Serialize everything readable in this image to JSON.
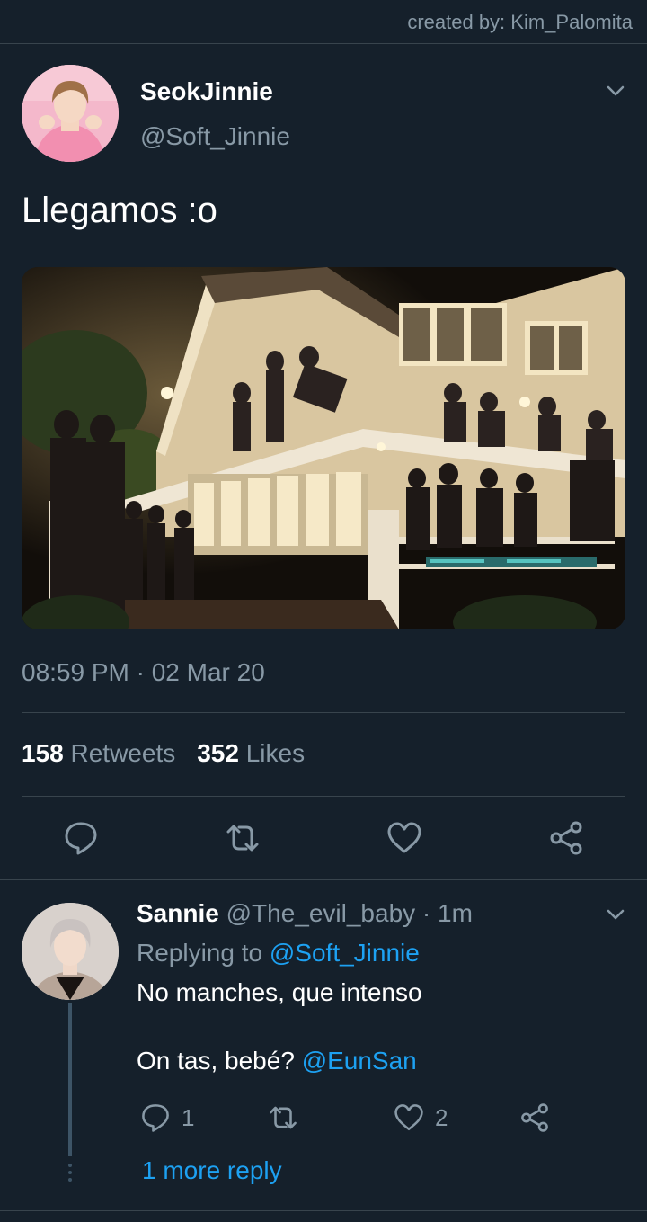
{
  "credit": "created by: Kim_Palomita",
  "tweet": {
    "display_name": "SeokJinnie",
    "handle": "@Soft_Jinnie",
    "text": "Llegamos :o",
    "timestamp": "08:59 PM · 02 Mar 20",
    "retweet_count": "158",
    "retweet_label": "Retweets",
    "like_count": "352",
    "like_label": "Likes"
  },
  "reply": {
    "display_name": "Sannie",
    "handle": "@The_evil_baby",
    "time": "· 1m",
    "replying_prefix": "Replying to",
    "replying_to": "@Soft_Jinnie",
    "line1": "No manches, que intenso",
    "line2_text": "On tas, bebé?",
    "line2_mention": "@EunSan",
    "reply_count": "1",
    "like_count": "2",
    "more_replies": "1 more reply"
  },
  "icons": {
    "reply": "reply-icon",
    "retweet": "retweet-icon",
    "like": "heart-icon",
    "share": "share-icon",
    "menu": "chevron-down-icon"
  },
  "colors": {
    "background": "#15202b",
    "secondary_text": "#8899a6",
    "link": "#1da1f2",
    "divider": "#38444d"
  }
}
